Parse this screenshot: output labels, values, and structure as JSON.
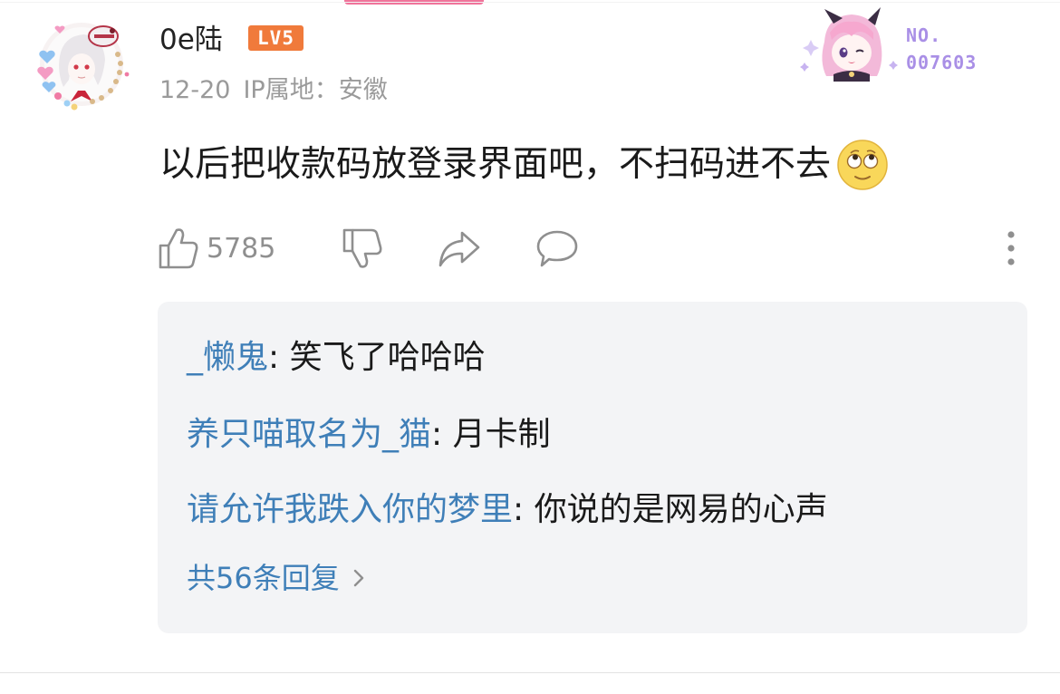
{
  "comment": {
    "username": "0e陆",
    "level": "LV5",
    "date": "12-20",
    "ip_location": "IP属地：安徽",
    "text": "以后把收款码放登录界面吧，不扫码进不去",
    "emoji": "rolling-eyes-face",
    "fan_card": {
      "no_label": "NO.",
      "number": "007603"
    },
    "actions": {
      "like_count": "5785",
      "icons": [
        "thumbs-up-icon",
        "thumbs-down-icon",
        "share-icon",
        "comment-bubble-icon",
        "more-vertical-icon"
      ]
    }
  },
  "replies": {
    "items": [
      {
        "user": "_懒鬼",
        "separator": ": ",
        "text": "笑飞了哈哈哈"
      },
      {
        "user": "养只喵取名为_猫",
        "separator": ": ",
        "text": "月卡制"
      },
      {
        "user": "请允许我跌入你的梦里",
        "separator": ": ",
        "text": "你说的是网易的心声"
      }
    ],
    "more_label": "共56条回复"
  },
  "colors": {
    "accent_pink": "#f0739b",
    "level_badge": "#f07a3b",
    "link_blue": "#3f7fb8",
    "meta_gray": "#9a9a9a",
    "reply_bg": "#f3f4f6",
    "fan_card_purple": "#a98fe6"
  }
}
